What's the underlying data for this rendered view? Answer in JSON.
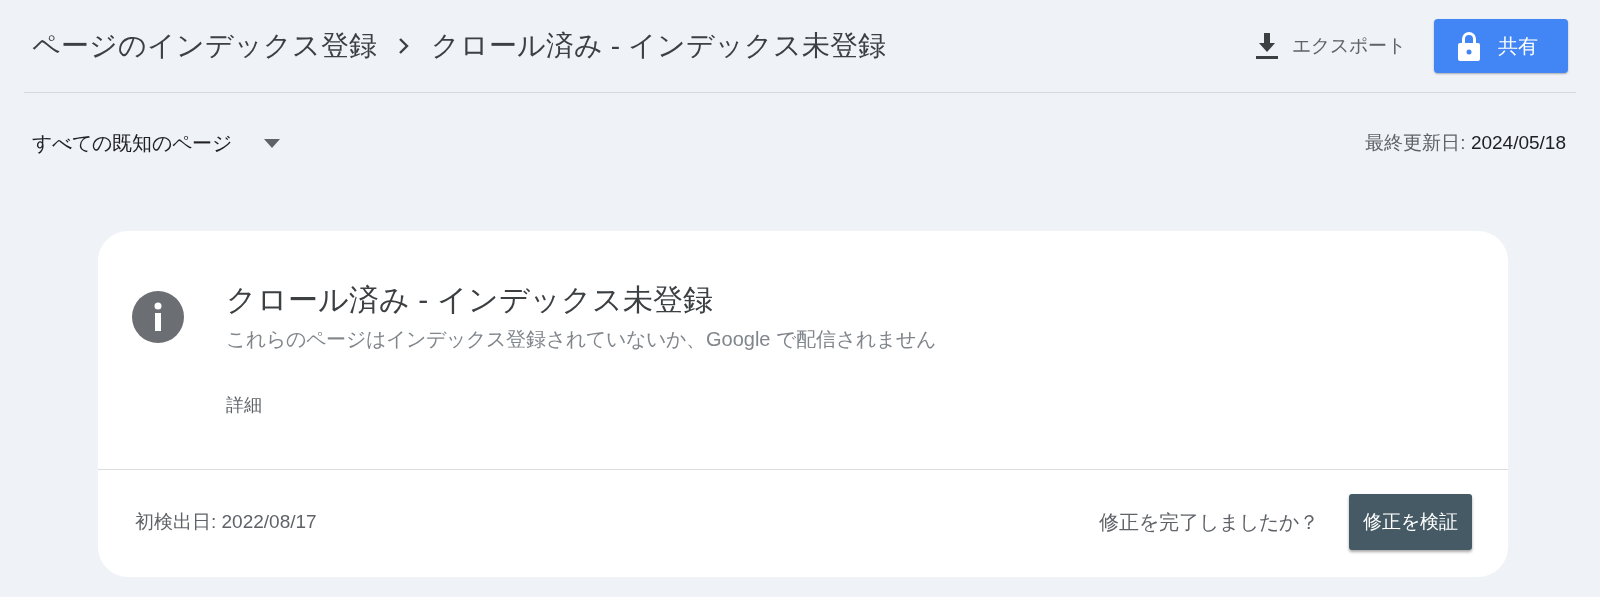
{
  "breadcrumb": [
    {
      "label": "ページのインデックス登録"
    },
    {
      "label": "クロール済み - インデックス未登録"
    }
  ],
  "actions": {
    "export": "エクスポート",
    "share": "共有"
  },
  "filter": {
    "label": "すべての既知のページ"
  },
  "last_updated": {
    "label": "最終更新日:",
    "value": "2024/05/18"
  },
  "card": {
    "title": "クロール済み - インデックス未登録",
    "description": "これらのページはインデックス登録されていないか、Google で配信されません",
    "details_link": "詳細",
    "first_detected": "初検出日: 2022/08/17",
    "question": "修正を完了しましたか？",
    "validate_button": "修正を検証"
  }
}
